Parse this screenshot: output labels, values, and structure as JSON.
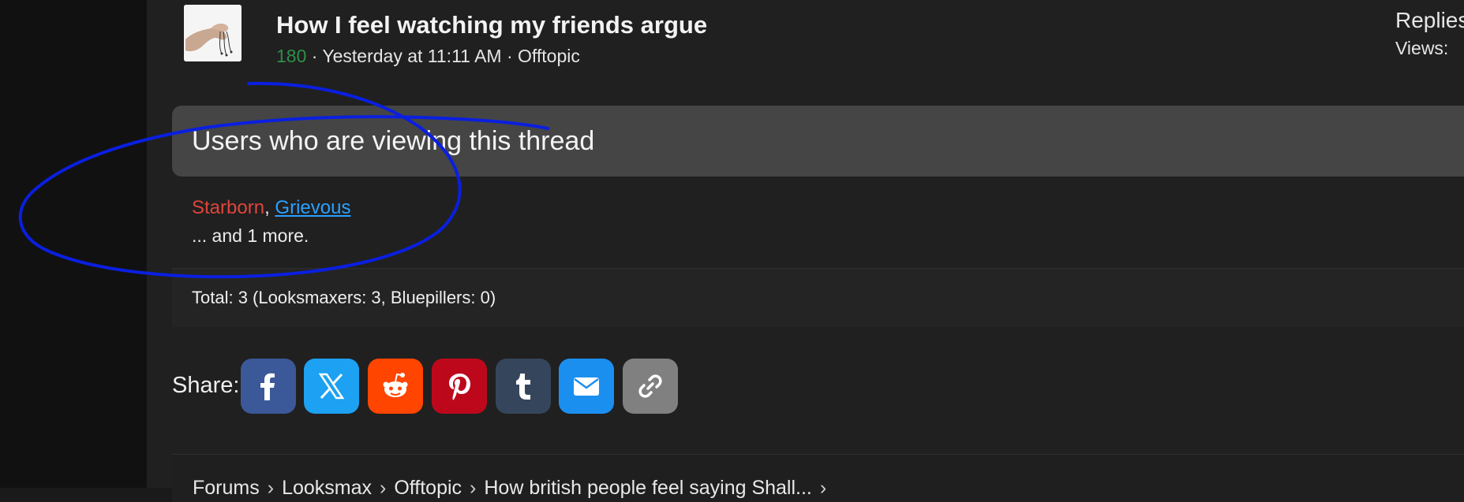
{
  "thread": {
    "title": "How I feel watching my friends argue",
    "meta_number": "180",
    "meta_rest": " · Yesterday at 11:11 AM · Offtopic",
    "thumbnail_icon": "hand-holding-strings-image",
    "replies_label": "Replies",
    "views_label": "Views:"
  },
  "viewers": {
    "title": "Users who are viewing this thread",
    "users": [
      "Starborn",
      "Grievous"
    ],
    "separator": ", ",
    "more": "... and 1 more.",
    "total": "Total: 3 (Looksmaxers: 3, Bluepillers: 0)",
    "colors": {
      "Starborn": "#e0443a",
      "Grievous": "#2aa0ff"
    }
  },
  "share": {
    "label": "Share:",
    "buttons": [
      {
        "name": "facebook",
        "icon": "facebook-icon",
        "color": "#3b5998"
      },
      {
        "name": "x",
        "icon": "x-icon",
        "color": "#1da1f2"
      },
      {
        "name": "reddit",
        "icon": "reddit-icon",
        "color": "#ff4500"
      },
      {
        "name": "pinterest",
        "icon": "pinterest-icon",
        "color": "#bd081c"
      },
      {
        "name": "tumblr",
        "icon": "tumblr-icon",
        "color": "#35465c"
      },
      {
        "name": "email",
        "icon": "email-icon",
        "color": "#1b8ff0"
      },
      {
        "name": "link",
        "icon": "link-icon",
        "color": "#808080"
      }
    ]
  },
  "breadcrumb": {
    "items": [
      "Forums",
      "Looksmax",
      "Offtopic",
      "How british people feel saying Shall..."
    ],
    "separator": "›"
  },
  "annotation": {
    "color": "#0a1fe0"
  }
}
